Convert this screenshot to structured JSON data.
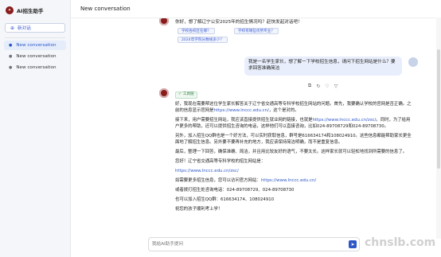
{
  "app": {
    "name": "AI招生助手"
  },
  "sidebar": {
    "new_chat_label": "新对话",
    "items": [
      {
        "label": "New conversation"
      },
      {
        "label": "New conversation"
      },
      {
        "label": "New conversation"
      }
    ]
  },
  "header": {
    "title": "New conversation"
  },
  "bot_greeting": {
    "text": "你好，想了解辽宁公安2025年的招生情况吗？赶快发起对话吧！",
    "suggestions": [
      "学校各校区在哪？",
      "学校有哪些优势专业？",
      "2024年学院分数线多少？"
    ]
  },
  "user_message": {
    "text": "我是一名学生家长，想了解一下学校招生信息，请问下招生网站是什么？要求回答准确简洁"
  },
  "answer": {
    "tool_tag": "工具链",
    "paragraphs": [
      [
        "好，我现在需要帮这位学生家长解答关于辽宁省交通高等专科学校招生网站的问题。首先，我要确认学校的官网是否正确。之前的信息显示官网是",
        {
          "link": "https://www.lnccc.edu.cn/"
        },
        "，这个是对的。"
      ],
      [
        "接下来，用户需要招生网站，我应该直接提供招生就业网的链接，也就是",
        {
          "link": "https://www.lnccc.edu.cn/zsc/"
        },
        "。同时，为了给用户更多的帮助，还可以提供招生咨询的电话，这样他们可以直接咨询，比如024-89708729和024-89708730。"
      ],
      [
        "另外，加入招生QQ群也是一个好方法，可以实时获取信息，群号是616634174和108024910。这些信息都能帮助家长更全面地了解招生信息。另外要不要再补充的地方，我应该保持简洁明确，而不是重复信息。"
      ],
      [
        "最后，整理一下回答，确保准确、简洁，并且用比较友好的语气，不要太长。这样家长就可以轻松地找到所需要的信息了。"
      ],
      [
        "您好！辽宁省交通高等专科学校的招生网站是："
      ],
      [
        {
          "link": "https://www.lnccc.edu.cn/zsc/"
        }
      ],
      [
        "如需要更多招生信息，您可以访问官方网站：",
        {
          "link": "https://www.lnccc.edu.cn/"
        }
      ],
      [
        "或者拨打招生处咨询电话：024-89708729、024-89708730"
      ],
      [
        "也可以加入招生QQ群：616634174、108024910"
      ],
      [
        "祝您的孩子顺利考上学！"
      ]
    ]
  },
  "input": {
    "placeholder": "我给AI助手提问"
  },
  "watermark": "chnslb.com",
  "colors": {
    "brand": "#8a1c1c",
    "accent": "#2f58c7"
  },
  "icons": [
    "logo",
    "new-chat-icon",
    "conversation-icon",
    "copy-icon",
    "refresh-icon",
    "like-icon",
    "dislike-icon",
    "send-icon"
  ]
}
